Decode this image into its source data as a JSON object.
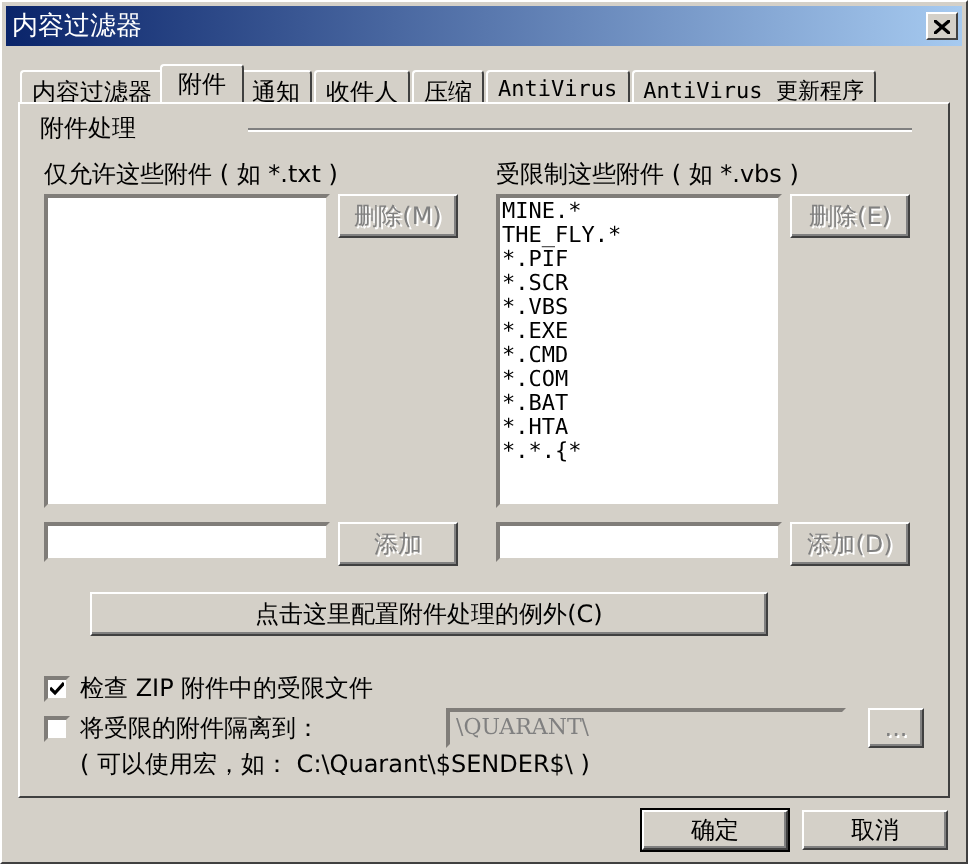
{
  "window": {
    "title": "内容过滤器"
  },
  "tabs": [
    {
      "label": "内容过滤器",
      "selected": false
    },
    {
      "label": "附件",
      "selected": true
    },
    {
      "label": "通知",
      "selected": false
    },
    {
      "label": "收件人",
      "selected": false
    },
    {
      "label": "压缩",
      "selected": false
    },
    {
      "label": "AntiVirus",
      "selected": false
    },
    {
      "label": "AntiVirus 更新程序",
      "selected": false
    }
  ],
  "group_title": "附件处理",
  "lists": [
    {
      "label": "仅允许这些附件 ( 如 *.txt )",
      "delete_button": {
        "label": "删除(M)",
        "disabled": true
      },
      "add_button": {
        "label": "添加",
        "disabled": true
      }
    },
    {
      "label": "受限制这些附件 ( 如 *.vbs )",
      "items": [
        "MINE.*",
        "THE_FLY.*",
        "*.PIF",
        "*.SCR",
        "*.VBS",
        "*.EXE",
        "*.CMD",
        "*.COM",
        "*.BAT",
        "*.HTA",
        "*.*.{*"
      ],
      "delete_button": {
        "label": "删除(E)",
        "disabled": true
      },
      "add_button": {
        "label": "添加(D)",
        "disabled": true
      }
    }
  ],
  "exceptions_button": {
    "label": "点击这里配置附件处理的例外(C)"
  },
  "checkboxes": [
    {
      "label": "检查 ZIP 附件中的受限文件",
      "checked": true
    },
    {
      "label": "将受限的附件隔离到：",
      "checked": false
    }
  ],
  "quarantine": {
    "value": "\\QUARANT\\",
    "disabled": true,
    "browse_button": {
      "label": "...",
      "disabled": true
    }
  },
  "hint": "( 可以使用宏，如： C:\\Quarant\\$SENDER$\\ )",
  "buttons": [
    {
      "label": "确定",
      "default": true
    },
    {
      "label": "取消",
      "default": false
    }
  ]
}
